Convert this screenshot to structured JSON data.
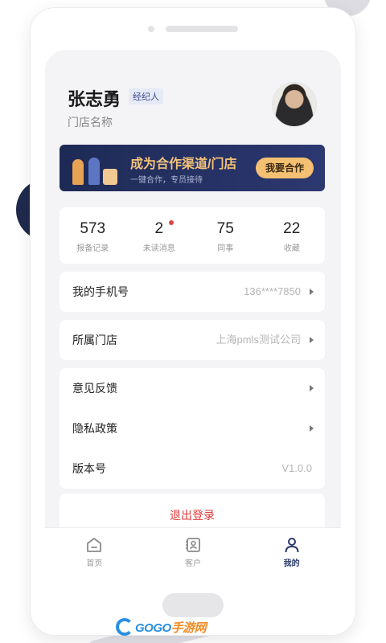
{
  "profile": {
    "name": "张志勇",
    "role": "经纪人",
    "store_name": "门店名称"
  },
  "banner": {
    "title": "成为合作渠道/门店",
    "subtitle": "一键合作，专员接待",
    "button_label": "我要合作"
  },
  "stats": [
    {
      "value": "573",
      "label": "报备记录"
    },
    {
      "value": "2",
      "label": "未读消息",
      "has_dot": true
    },
    {
      "value": "75",
      "label": "同事"
    },
    {
      "value": "22",
      "label": "收藏"
    }
  ],
  "info": {
    "phone_label": "我的手机号",
    "phone_value": "136****7850",
    "store_label": "所属门店",
    "store_value": "上海pmls测试公司"
  },
  "settings": {
    "feedback_label": "意见反馈",
    "privacy_label": "隐私政策",
    "version_label": "版本号",
    "version_value": "V1.0.0"
  },
  "logout_label": "退出登录",
  "tabbar": {
    "tabs": [
      {
        "label": "首页",
        "icon": "home-icon",
        "active": false
      },
      {
        "label": "客户",
        "icon": "contacts-icon",
        "active": false
      },
      {
        "label": "我的",
        "icon": "user-icon",
        "active": true
      }
    ]
  },
  "watermark": {
    "text_main": "GOGO",
    "text_accent": "手游网"
  },
  "colors": {
    "accent": "#2a3a6a",
    "banner_bg": "#1e2a55",
    "banner_gold": "#f4c072",
    "logout_red": "#e03a3a",
    "unread_dot": "#e04343"
  }
}
